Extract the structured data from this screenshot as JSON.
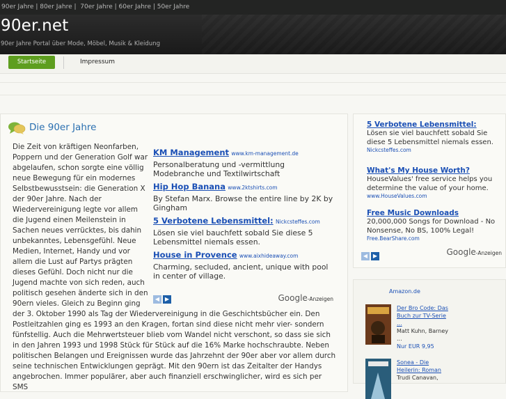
{
  "topbar": {
    "links": "90er Jahre | 80er Jahre |  70er Jahre | 60er Jahre | 50er Jahre"
  },
  "header": {
    "site_title": "90er.net",
    "tagline": "90er Jahre Portal über Mode, Möbel, Musik & Kleidung"
  },
  "nav": {
    "home": "Startseite",
    "imprint": "Impressum"
  },
  "main": {
    "title": "Die 90er Jahre",
    "article": "Die Zeit von kräftigen Neonfarben, Poppern und der Generation Golf war abgelaufen, schon sorgte eine völlig neue Bewegung für ein modernes Selbstbewusstsein: die Generation X der 90er Jahre. Nach der Wiedervereinigung legte vor allem die Jugend einen Meilenstein in Sachen neues verrücktes, bis dahin unbekanntes, Lebensgefühl. Neue Medien, Internet, Handy und vor allem die Lust auf Partys prägten dieses Gefühl. Doch nicht nur die Jugend machte von sich reden, auch politisch gesehen änderte sich in den 90ern vieles. Gleich zu Beginn ging der 3. Oktober 1990 als Tag der Wiedervereinigung in die Geschichtsbücher ein. Den Postleitzahlen ging es 1993 an den Kragen, fortan sind diese nicht mehr vier- sondern fünfstellig. Auch die Mehrwertsteuer blieb vom Wandel nicht verschont, so dass sie sich in den Jahren 1993 und 1998 Stück für Stück auf die 16% Marke hochschraubte. Neben politischen Belangen und Ereignissen wurde das Jahrzehnt der 90er aber vor allem durch seine technischen Entwicklungen geprägt. Mit den 90ern ist das Zeitalter der Handys angebrochen. Immer populärer, aber auch finanziell erschwinglicher, wird es sich per SMS"
  },
  "ads_main": [
    {
      "title": "KM Management",
      "url": "www.km-management.de",
      "desc": "Personalberatung und -vermittlung Modebranche und Textilwirtschaft"
    },
    {
      "title": "Hip Hop Banana",
      "url": "www.2ktshirts.com",
      "desc": "By Stefan Marx. Browse the entire line by 2K by Gingham"
    },
    {
      "title": "5 Verbotene Lebensmittel:",
      "url": "Nickcsteffes.com",
      "desc": "Lösen sie viel bauchfett sobald Sie diese 5 Lebensmittel niemals essen."
    },
    {
      "title": "House in Provence",
      "url": "www.aixhideaway.com",
      "desc": "Charming, secluded, ancient, unique with pool in center of village."
    }
  ],
  "ads_side": [
    {
      "title": "5 Verbotene Lebensmittel:",
      "desc": "Lösen sie viel bauchfett sobald Sie diese 5 Lebensmittel niemals essen.",
      "url": "Nickcsteffes.com"
    },
    {
      "title": "What's My House Worth?",
      "desc": "HouseValues' free service helps you determine the value of your home.",
      "url": "www.HouseValues.com"
    },
    {
      "title": "Free Music Downloads",
      "desc": "20,000,000 Songs for Download - No Nonsense, No BS, 100% Legal!",
      "url": "Free.BearShare.com"
    }
  ],
  "google": {
    "brand": "Google",
    "suffix": "-Anzeigen"
  },
  "amazon": {
    "label": "Amazon.de",
    "books": [
      {
        "title1": "Der Bro Code: Das",
        "title2": "Buch zur TV-Serie",
        "title3": "...",
        "author": "Matt Kuhn, Barney",
        "author2": "...",
        "price": "Nur EUR 9,95"
      },
      {
        "title1": "Sonea - Die",
        "title2": "Heilerin: Roman",
        "author": "Trudi Canavan,"
      }
    ]
  },
  "colors": {
    "accent_green": "#5e9e1f",
    "link_blue": "#1a4fb5",
    "title_blue": "#2a6fb0",
    "header_dark": "#232423"
  }
}
